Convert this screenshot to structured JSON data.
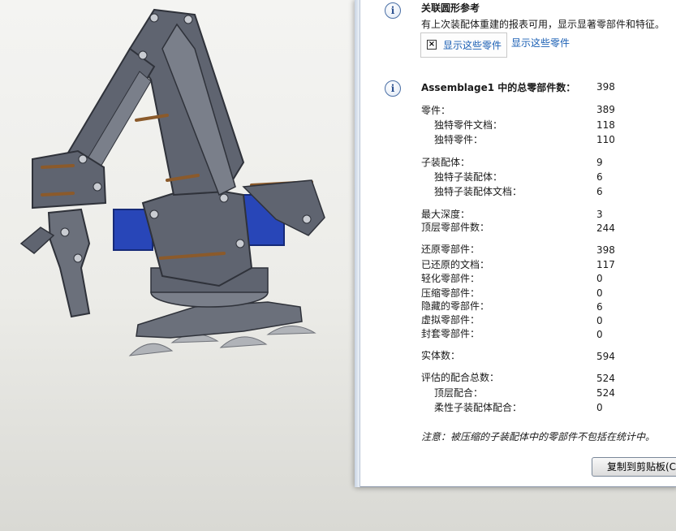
{
  "graphics": {
    "section_title": "关联圆形参考",
    "description": "有上次装配体重建的报表可用，显示显著零部件和特征。",
    "show_button_label": "显示这些零件",
    "show_link_label": "显示这些零件"
  },
  "summary": {
    "heading": "Assemblage1 中的总零部件数：",
    "heading_value": "398",
    "rows": [
      {
        "label": "零件：",
        "value": "389"
      },
      {
        "label": "独特零件文档：",
        "value": "118"
      },
      {
        "label": "独特零件：",
        "value": "110"
      },
      {
        "label": "子装配体：",
        "value": "9"
      },
      {
        "label": "独特子装配体：",
        "value": "6"
      },
      {
        "label": "独特子装配体文档：",
        "value": "6"
      },
      {
        "label": "最大深度：",
        "value": "3"
      },
      {
        "label": "顶层零部件数：",
        "value": "244"
      },
      {
        "label": "还原零部件：",
        "value": "398"
      },
      {
        "label": "已还原的文档：",
        "value": "117"
      },
      {
        "label": "轻化零部件：",
        "value": "0"
      },
      {
        "label": "压缩零部件：",
        "value": "0"
      },
      {
        "label": "隐藏的零部件：",
        "value": "6"
      },
      {
        "label": "虚拟零部件：",
        "value": "0"
      },
      {
        "label": "封套零部件：",
        "value": "0"
      },
      {
        "label": "实体数：",
        "value": "594"
      },
      {
        "label": "评估的配合总数：",
        "value": "524"
      },
      {
        "label": "顶层配合：",
        "value": "524"
      },
      {
        "label": "柔性子装配体配合：",
        "value": "0"
      }
    ],
    "note": "注意：被压缩的子装配体中的零部件不包括在统计中。"
  },
  "footer": {
    "copy_button_label": "复制到剪贴板(C)"
  },
  "colors": {
    "link": "#1a5fb4",
    "robot_body": "#5f6470",
    "robot_dark": "#3e424c",
    "servo_blue": "#2846b8",
    "wood": "#8b5a2b",
    "suction": "#b0b3b8"
  }
}
